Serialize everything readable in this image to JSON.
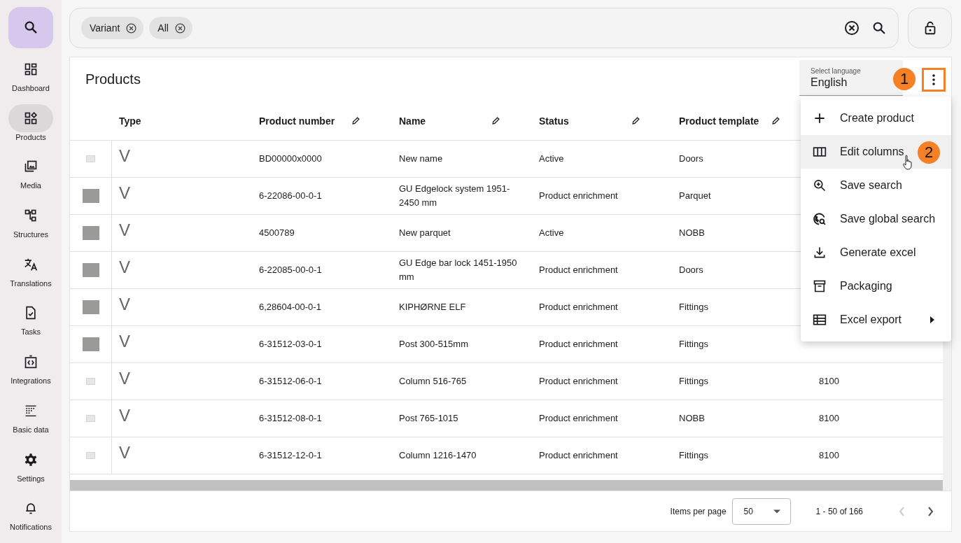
{
  "sidebar": {
    "items": [
      {
        "label": "Dashboard",
        "selected": false
      },
      {
        "label": "Products",
        "selected": true
      },
      {
        "label": "Media",
        "selected": false
      },
      {
        "label": "Structures",
        "selected": false
      },
      {
        "label": "Translations",
        "selected": false
      },
      {
        "label": "Tasks",
        "selected": false
      },
      {
        "label": "Integrations",
        "selected": false
      },
      {
        "label": "Basic data",
        "selected": false
      },
      {
        "label": "Settings",
        "selected": false
      },
      {
        "label": "Notifications",
        "selected": false
      }
    ]
  },
  "search": {
    "chips": [
      "Variant",
      "All"
    ]
  },
  "products": {
    "title": "Products",
    "language": {
      "label": "Select language",
      "value": "English"
    },
    "columns": [
      {
        "label": "Type",
        "editable": false
      },
      {
        "label": "Product number",
        "editable": true
      },
      {
        "label": "Name",
        "editable": true
      },
      {
        "label": "Status",
        "editable": true
      },
      {
        "label": "Product template",
        "editable": true
      },
      {}
    ],
    "rows": [
      {
        "kind": "placeholder",
        "cells": [
          "V",
          "BD00000x0000",
          "New name",
          "Active",
          "Doors"
        ]
      },
      {
        "kind": "photo",
        "cells": [
          "V",
          "6-22086-00-0-1",
          "GU Edgelock system 1951-2450 mm",
          "Product enrichment",
          "Parquet"
        ]
      },
      {
        "kind": "photo",
        "cells": [
          "V",
          "4500789",
          "New parquet",
          "Active",
          "NOBB"
        ]
      },
      {
        "kind": "photo",
        "cells": [
          "V",
          "6-22085-00-0-1",
          "GU Edge bar lock 1451-1950 mm",
          "Product enrichment",
          "Doors"
        ]
      },
      {
        "kind": "photo",
        "cells": [
          "V",
          "6,28604-00-0-1",
          "KIPHØRNE ELF",
          "Product enrichment",
          "Fittings"
        ]
      },
      {
        "kind": "photo",
        "cells": [
          "V",
          "6-31512-03-0-1",
          "Post 300-515mm",
          "Product enrichment",
          "Fittings"
        ]
      },
      {
        "kind": "placeholder",
        "cells": [
          "V",
          "6-31512-06-0-1",
          "Column 516-765",
          "Product enrichment",
          "Fittings",
          "8100"
        ]
      },
      {
        "kind": "placeholder",
        "cells": [
          "V",
          "6-31512-08-0-1",
          "Post 765-1015",
          "Product enrichment",
          "NOBB",
          "8100"
        ]
      },
      {
        "kind": "placeholder",
        "cells": [
          "V",
          "6-31512-12-0-1",
          "Column 1216-1470",
          "Product enrichment",
          "Fittings",
          "8100"
        ]
      }
    ],
    "pagination": {
      "label": "Items per page",
      "page_size": "50",
      "range": "1 - 50 of 166",
      "previous_disabled": true,
      "next_disabled": false
    }
  },
  "menu": {
    "items": [
      {
        "label": "Create product",
        "highlighted": false,
        "submenu": false
      },
      {
        "label": "Edit columns",
        "highlighted": true,
        "submenu": false
      },
      {
        "label": "Save search",
        "highlighted": false,
        "submenu": false
      },
      {
        "label": "Save global search",
        "highlighted": false,
        "submenu": false
      },
      {
        "label": "Generate excel",
        "highlighted": false,
        "submenu": false
      },
      {
        "label": "Packaging",
        "highlighted": false,
        "submenu": false
      },
      {
        "label": "Excel export",
        "highlighted": false,
        "submenu": true
      }
    ]
  },
  "callouts": [
    "1",
    "2"
  ]
}
